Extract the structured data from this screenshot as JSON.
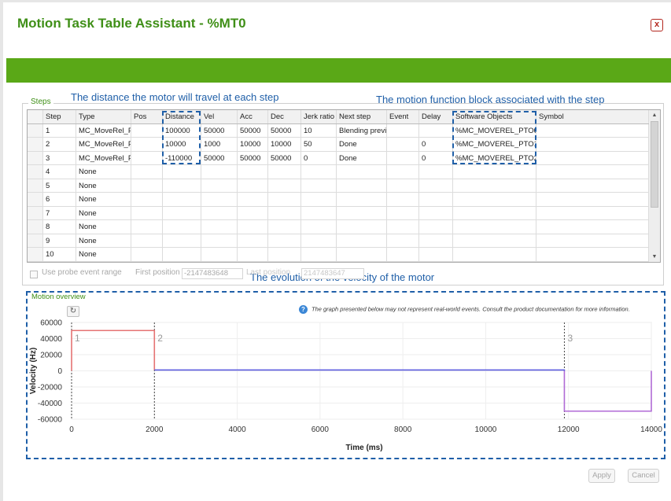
{
  "window": {
    "title": "Motion Task Table Assistant - %MT0",
    "close_symbol": "x"
  },
  "annotations": {
    "distance": "The distance the motor  will travel at each step",
    "software_objects": "The motion function block associated with the step",
    "velocity": "The evolution of the velocity of the motor"
  },
  "steps": {
    "legend": "Steps",
    "columns": [
      "Step",
      "Type",
      "Pos",
      "Distance",
      "Vel",
      "Acc",
      "Dec",
      "Jerk ratio",
      "Next step",
      "Event",
      "Delay",
      "Software Objects",
      "Symbol"
    ],
    "rows": [
      [
        "1",
        "MC_MoveRel_P",
        "",
        "100000",
        "50000",
        "50000",
        "50000",
        "10",
        "Blending previ",
        "",
        "",
        "%MC_MOVEREL_PTO0",
        ""
      ],
      [
        "2",
        "MC_MoveRel_P",
        "",
        "10000",
        "1000",
        "10000",
        "10000",
        "50",
        "Done",
        "",
        "0",
        "%MC_MOVEREL_PTO1",
        ""
      ],
      [
        "3",
        "MC_MoveRel_P",
        "",
        "-110000",
        "50000",
        "50000",
        "50000",
        "0",
        "Done",
        "",
        "0",
        "%MC_MOVEREL_PTO2",
        ""
      ],
      [
        "4",
        "None",
        "",
        "",
        "",
        "",
        "",
        "",
        "",
        "",
        "",
        "",
        ""
      ],
      [
        "5",
        "None",
        "",
        "",
        "",
        "",
        "",
        "",
        "",
        "",
        "",
        "",
        ""
      ],
      [
        "6",
        "None",
        "",
        "",
        "",
        "",
        "",
        "",
        "",
        "",
        "",
        "",
        ""
      ],
      [
        "7",
        "None",
        "",
        "",
        "",
        "",
        "",
        "",
        "",
        "",
        "",
        "",
        ""
      ],
      [
        "8",
        "None",
        "",
        "",
        "",
        "",
        "",
        "",
        "",
        "",
        "",
        "",
        ""
      ],
      [
        "9",
        "None",
        "",
        "",
        "",
        "",
        "",
        "",
        "",
        "",
        "",
        "",
        ""
      ],
      [
        "10",
        "None",
        "",
        "",
        "",
        "",
        "",
        "",
        "",
        "",
        "",
        "",
        ""
      ]
    ]
  },
  "probe": {
    "checkbox_label": "Use probe event range",
    "first_position_label": "First position",
    "first_position_value": "-2147483648",
    "last_position_label": "Last position",
    "last_position_value": "2147483647"
  },
  "motion_overview": {
    "legend": "Motion overview",
    "info_note": "The graph presented below may not represent real-world events. Consult the product documentation for more information."
  },
  "chart_data": {
    "type": "line",
    "xlabel": "Time (ms)",
    "ylabel": "Velocity (Hz)",
    "xlim": [
      0,
      14000
    ],
    "ylim": [
      -60000,
      60000
    ],
    "x_ticks": [
      0,
      2000,
      4000,
      6000,
      8000,
      10000,
      12000,
      14000
    ],
    "y_ticks": [
      60000,
      40000,
      20000,
      0,
      -20000,
      -40000,
      -60000
    ],
    "grid": true,
    "step_markers": [
      {
        "label": "1",
        "x": 0
      },
      {
        "label": "2",
        "x": 2000
      },
      {
        "label": "3",
        "x": 11900
      }
    ],
    "series": [
      {
        "color": "#e57373",
        "points": [
          [
            0,
            0
          ],
          [
            0,
            50000
          ],
          [
            2000,
            50000
          ],
          [
            2000,
            1000
          ]
        ]
      },
      {
        "color": "#5c5ce0",
        "points": [
          [
            2000,
            1000
          ],
          [
            11900,
            1000
          ],
          [
            11900,
            0
          ]
        ]
      },
      {
        "color": "#b06ad6",
        "points": [
          [
            11900,
            0
          ],
          [
            11900,
            -50000
          ],
          [
            14000,
            -50000
          ],
          [
            14000,
            0
          ]
        ]
      }
    ]
  },
  "buttons": {
    "apply": "Apply",
    "cancel": "Cancel"
  },
  "colors": {
    "title": "#3f8f17",
    "bar": "#5aa817",
    "annotation": "#1f5fa8"
  }
}
